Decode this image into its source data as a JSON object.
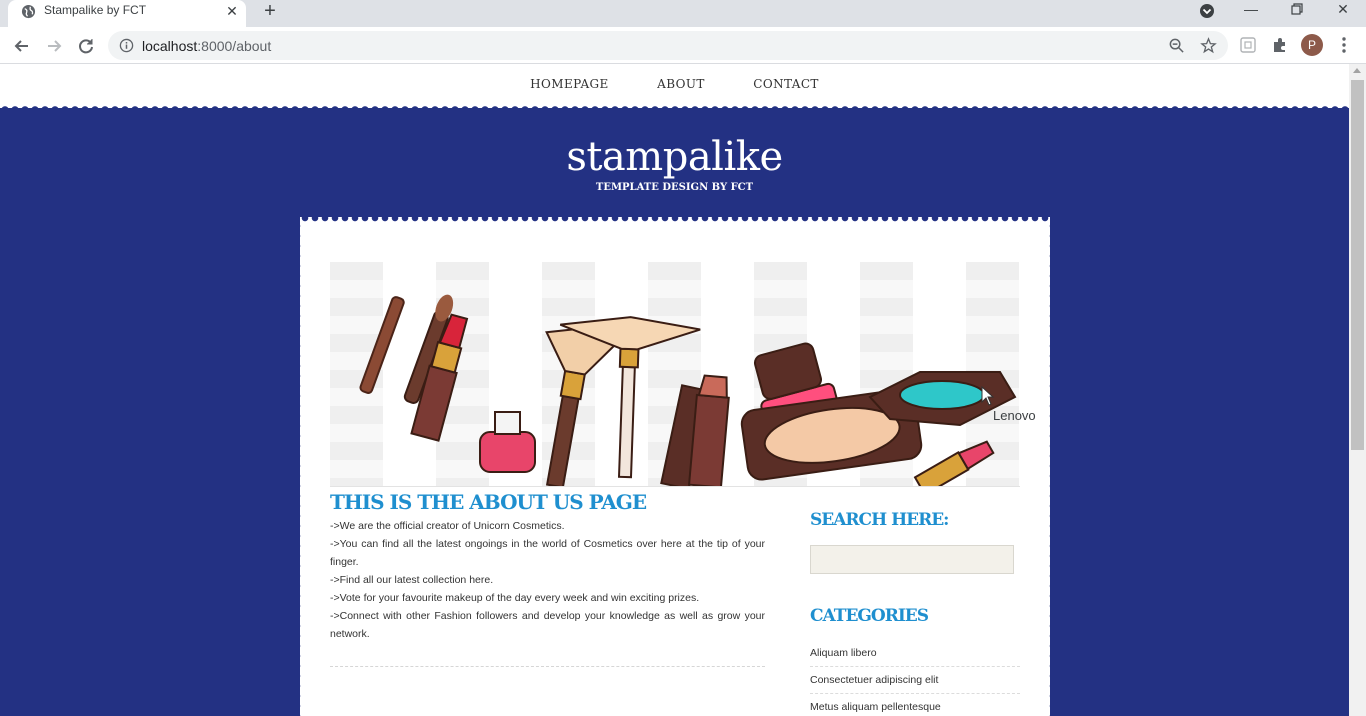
{
  "browser": {
    "tab_title": "Stampalike by FCT",
    "url_host": "localhost",
    "url_port_path": ":8000/about",
    "profile_initial": "P"
  },
  "site": {
    "nav": [
      "HOMEPAGE",
      "ABOUT",
      "CONTACT"
    ],
    "logo": "stampalike",
    "tagline": "TEMPLATE DESIGN BY FCT",
    "page_heading": "THIS IS THE ABOUT US PAGE",
    "about_lines": [
      "->We are the official creator of Unicorn Cosmetics.",
      "->You can find all the latest ongoings in the world of Cosmetics over here at the tip of your finger.",
      "->Find all our latest collection here.",
      "->Vote for your favourite makeup of the day every week and win exciting prizes.",
      "->Connect with other Fashion followers and develop your knowledge as well as grow your network."
    ],
    "search_heading": "SEARCH HERE:",
    "search_value": "",
    "categories_heading": "CATEGORIES",
    "categories": [
      "Aliquam libero",
      "Consectetuer adipiscing elit",
      "Metus aliquam pellentesque"
    ]
  },
  "overlay": {
    "tooltip": "Lenovo"
  },
  "colors": {
    "brand_blue": "#233183",
    "heading_blue": "#1f8fcf"
  }
}
